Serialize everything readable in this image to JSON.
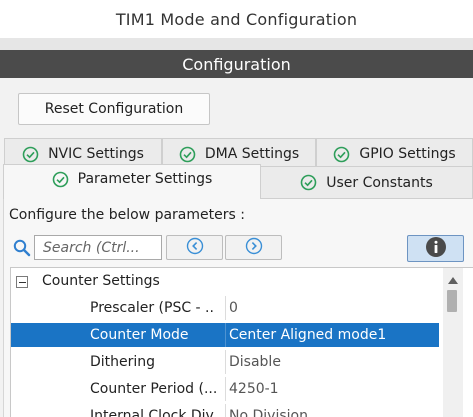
{
  "window": {
    "title": "TIM1 Mode and Configuration"
  },
  "configuration": {
    "header": "Configuration",
    "reset_button": "Reset Configuration"
  },
  "tabs": {
    "row1": [
      {
        "label": "NVIC Settings",
        "icon": "check-circle-icon"
      },
      {
        "label": "DMA Settings",
        "icon": "check-circle-icon"
      },
      {
        "label": "GPIO Settings",
        "icon": "check-circle-icon"
      }
    ],
    "row2": [
      {
        "label": "Parameter Settings",
        "icon": "check-circle-icon",
        "active": true
      },
      {
        "label": "User Constants",
        "icon": "check-circle-icon"
      }
    ]
  },
  "params": {
    "instruction": "Configure the below parameters :",
    "search_placeholder": "Search (Ctrl...",
    "section": "Counter Settings",
    "rows": [
      {
        "name": "Prescaler (PSC - ..",
        "value": "0"
      },
      {
        "name": "Counter Mode",
        "value": "Center Aligned mode1",
        "selected": true
      },
      {
        "name": "Dithering",
        "value": "Disable"
      },
      {
        "name": "Counter Period (...",
        "value": "4250-1"
      },
      {
        "name": "Internal Clock Div...",
        "value": "No Division"
      }
    ]
  },
  "colors": {
    "accent": "#1a74c5",
    "check": "#2e9e5a",
    "header_bar": "#4b4b4b",
    "nav_arrow": "#3a8fd6"
  }
}
